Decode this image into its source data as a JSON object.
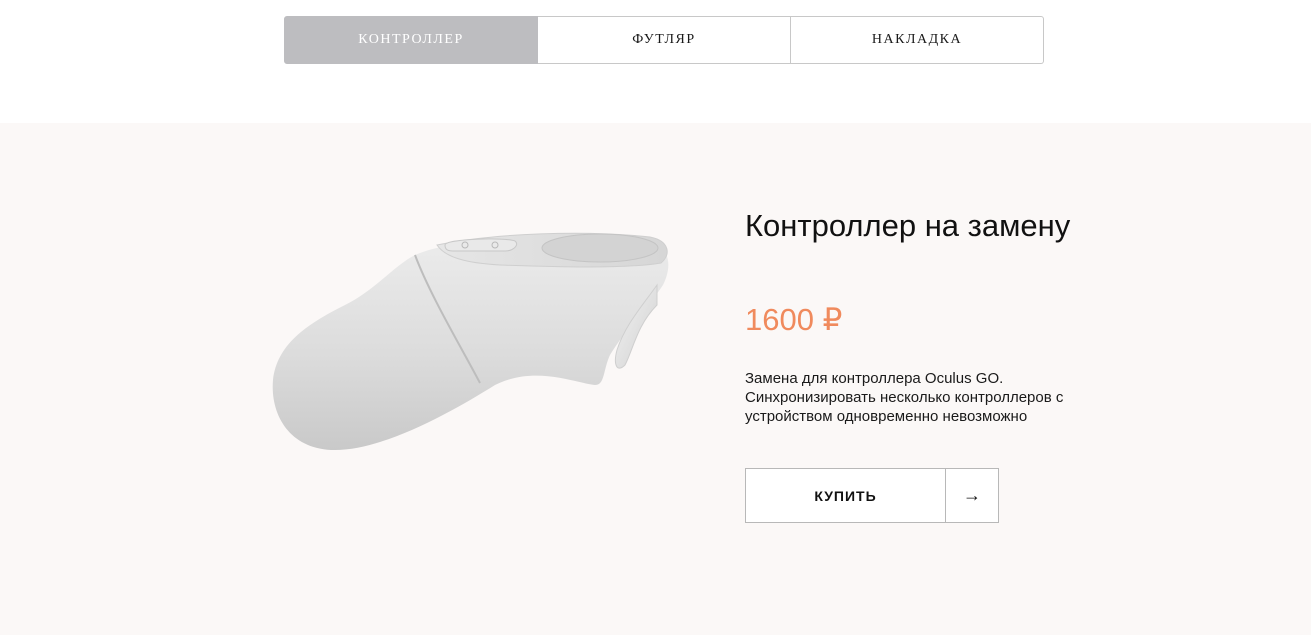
{
  "tabs": [
    {
      "label": "КОНТРОЛЛЕР",
      "active": true
    },
    {
      "label": "ФУТЛЯР",
      "active": false
    },
    {
      "label": "НАКЛАДКА",
      "active": false
    }
  ],
  "product": {
    "title": "Контроллер на замену",
    "price": "1600 ₽",
    "description": "Замена для контроллера Oculus GO. Синхронизировать несколько контроллеров с устройством одновременно невозможно",
    "buy_label": "КУПИТЬ",
    "buy_arrow": "→",
    "image_name": "oculus-go-controller"
  },
  "colors": {
    "active_tab": "#bdbdc0",
    "price": "#f08a5d",
    "section_bg": "#fbf8f7"
  }
}
